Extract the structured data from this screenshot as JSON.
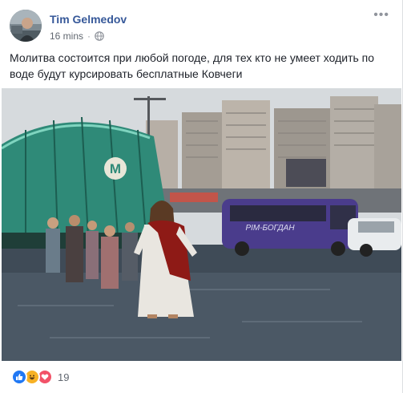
{
  "post": {
    "author": "Tim Gelmedov",
    "time": "16 mins",
    "separator": "·",
    "privacy_icon": "globe-icon",
    "menu_icon": "more-options-icon",
    "menu_glyph": "•••",
    "text": "Молитва состоится при любой погоде, для тех кто не умеет ходить по воде будут курсировать бесплатные Ковчеги"
  },
  "photo": {
    "metro_sign": "M",
    "minibus_text": "РІМ-БОГДАН",
    "description_colors": {
      "sky": "#d9dde0",
      "water": "#3d4a57",
      "dome": "#2f8a78",
      "minibus": "#4a3c8c",
      "robe": "#8e1a16"
    }
  },
  "reactions": {
    "icons": [
      "like-icon",
      "haha-icon",
      "love-icon"
    ],
    "count": "19"
  }
}
